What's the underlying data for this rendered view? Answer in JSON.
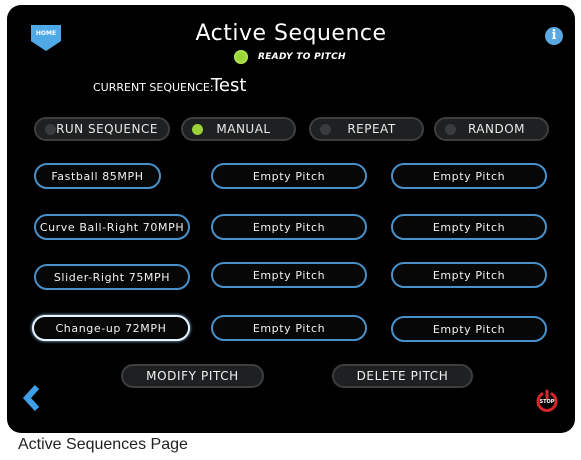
{
  "header": {
    "home_label": "HOME",
    "title": "Active Sequence",
    "info_glyph": "i"
  },
  "status": {
    "text": "READY TO PITCH",
    "indicator_color": "#9bd23a"
  },
  "sequence": {
    "label": "CURRENT SEQUENCE:",
    "value": "Test"
  },
  "modes": [
    {
      "label": "RUN SEQUENCE",
      "active": false
    },
    {
      "label": "MANUAL",
      "active": true
    },
    {
      "label": "REPEAT",
      "active": false
    },
    {
      "label": "RANDOM",
      "active": false
    }
  ],
  "pitch_grid": [
    [
      "Fastball 85MPH",
      "Empty Pitch",
      "Empty Pitch"
    ],
    [
      "Curve Ball-Right 70MPH",
      "Empty Pitch",
      "Empty Pitch"
    ],
    [
      "Slider-Right 75MPH",
      "Empty Pitch",
      "Empty Pitch"
    ],
    [
      "Change-up 72MPH",
      "Empty Pitch",
      "Empty Pitch"
    ]
  ],
  "selected_pitch": "Change-up 72MPH",
  "actions": {
    "modify": "MODIFY PITCH",
    "delete": "DELETE PITCH"
  },
  "footer": {
    "back_icon": "chevron-left-icon",
    "stop_icon": "power-stop-icon",
    "stop_label": "STOP"
  },
  "caption": "Active Sequences Page",
  "colors": {
    "accent_blue": "#4fa9e6",
    "button_border": "#4a90c8",
    "stop_red": "#d8262a"
  }
}
